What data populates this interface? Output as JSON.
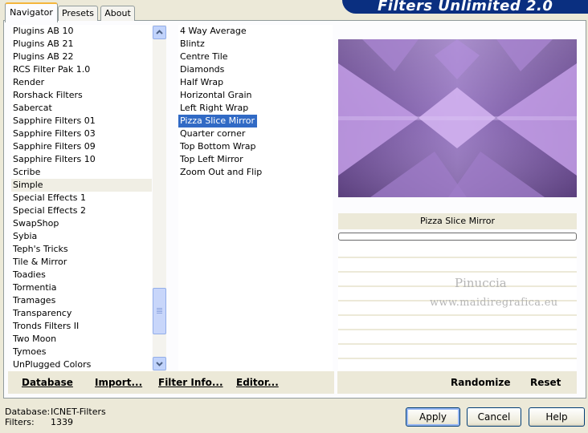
{
  "banner": {
    "title": "Filters Unlimited 2.0"
  },
  "tabs": [
    {
      "label": "Navigator",
      "active": true
    },
    {
      "label": "Presets",
      "active": false
    },
    {
      "label": "About",
      "active": false
    }
  ],
  "categories": {
    "items": [
      "Plugins AB 10",
      "Plugins AB 21",
      "Plugins AB 22",
      "RCS Filter Pak 1.0",
      "Render",
      "Rorshack Filters",
      "Sabercat",
      "Sapphire Filters 01",
      "Sapphire Filters 03",
      "Sapphire Filters 09",
      "Sapphire Filters 10",
      "Scribe",
      "Simple",
      "Special Effects 1",
      "Special Effects 2",
      "SwapShop",
      "Sybia",
      "Teph's Tricks",
      "Tile & Mirror",
      "Toadies",
      "Tormentia",
      "Tramages",
      "Transparency",
      "Tronds Filters II",
      "Two Moon",
      "Tymoes",
      "UnPlugged Colors"
    ],
    "selected": "Simple"
  },
  "filters": {
    "items": [
      "4 Way Average",
      "Blintz",
      "Centre Tile",
      "Diamonds",
      "Half Wrap",
      "Horizontal Grain",
      "Left Right Wrap",
      "Pizza Slice Mirror",
      "Quarter corner",
      "Top Bottom Wrap",
      "Top Left Mirror",
      "Zoom Out and Flip"
    ],
    "selected": "Pizza Slice Mirror"
  },
  "left_bar": {
    "database": "Database",
    "import": "Import...",
    "filter_info": "Filter Info...",
    "editor": "Editor..."
  },
  "preview": {
    "filter_name": "Pizza Slice Mirror",
    "progress": 0,
    "watermark_line1": "Pinuccia",
    "watermark_line2": "www.maidiregrafica.eu"
  },
  "right_bar": {
    "randomize": "Randomize",
    "reset": "Reset"
  },
  "status": {
    "database_label": "Database:",
    "database_value": "ICNET-Filters",
    "filters_label": "Filters:",
    "filters_value": "1339"
  },
  "buttons": {
    "apply": "Apply",
    "cancel": "Cancel",
    "help": "Help"
  },
  "colors": {
    "selection": "#316ac5",
    "banner": "#0a2f80",
    "preview_purple": "#7d5aa3"
  },
  "icons": {
    "scroll_up": "chevron-up-icon",
    "scroll_down": "chevron-down-icon"
  }
}
